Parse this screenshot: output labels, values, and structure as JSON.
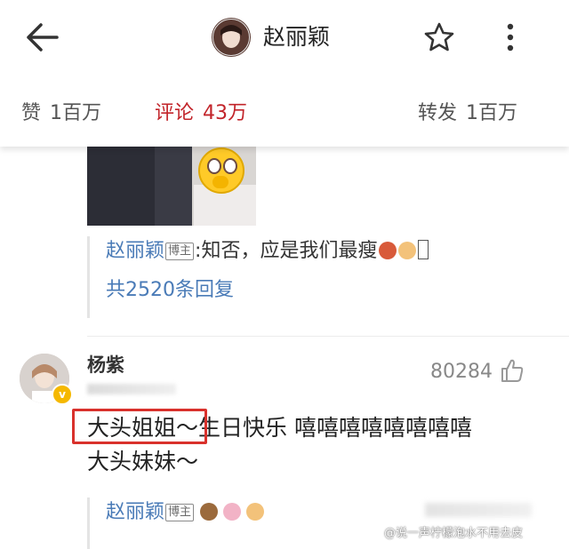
{
  "header": {
    "title": "赵丽颖",
    "back_icon": "arrow-left-icon",
    "favorite_icon": "star-icon",
    "more_icon": "more-vertical-icon",
    "stats": {
      "likes_label": "赞",
      "likes_value": "1百万",
      "comments_label": "评论",
      "comments_value": "43万",
      "reposts_label": "转发",
      "reposts_value": "1百万"
    },
    "accent_color": "#c2242a"
  },
  "thread1": {
    "reply_author": "赵丽颖",
    "reply_badge": "博主",
    "reply_text": ":知否，应是我们最瘦",
    "reply_count": "共2520条回复"
  },
  "comment2": {
    "author": "杨紫",
    "like_count": "80284",
    "like_icon": "thumbs-up-icon",
    "body_highlight": "大头姐姐～",
    "body_rest": "生日快乐 嘻嘻嘻嘻嘻嘻嘻嘻",
    "body_line2": "大头妹妹～",
    "reply_author": "赵丽颖",
    "reply_badge": "博主"
  },
  "watermark": {
    "text": "@说一声柠檬泡水不用去皮"
  },
  "colors": {
    "link_blue": "#4a7bb7",
    "highlight_red": "#d9312c",
    "muted": "#888888"
  }
}
